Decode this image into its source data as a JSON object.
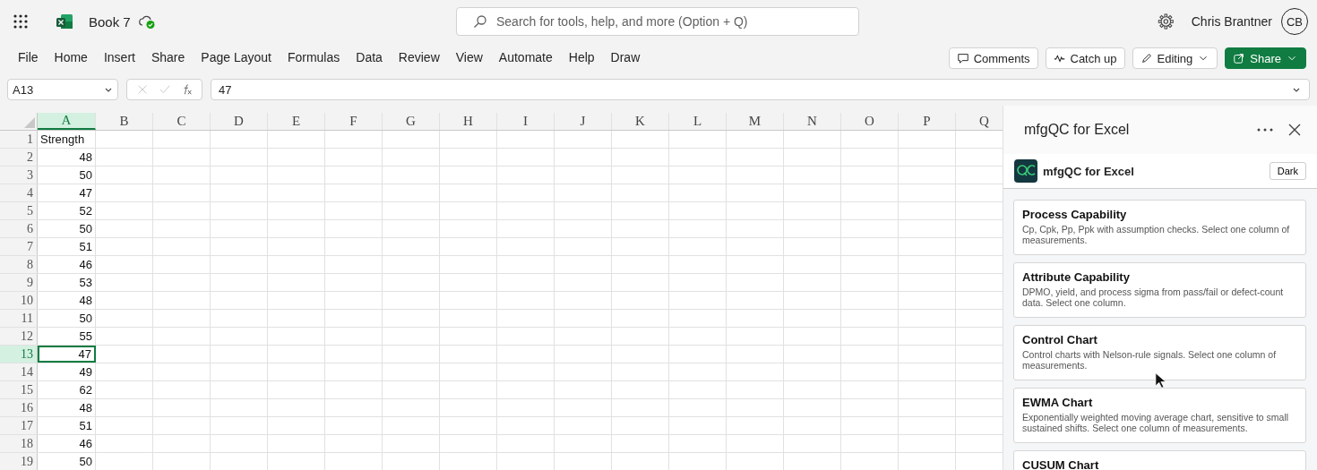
{
  "app_bar": {
    "file_name": "Book 7",
    "search_placeholder": "Search for tools, help, and more (Option + Q)",
    "user_name": "Chris Brantner",
    "user_initials": "CB"
  },
  "menu_tabs": [
    {
      "label": "File",
      "selected": false
    },
    {
      "label": "Home",
      "selected": false
    },
    {
      "label": "Insert",
      "selected": false
    },
    {
      "label": "Share",
      "selected": false
    },
    {
      "label": "Page Layout",
      "selected": false
    },
    {
      "label": "Formulas",
      "selected": false
    },
    {
      "label": "Data",
      "selected": false
    },
    {
      "label": "Review",
      "selected": false
    },
    {
      "label": "View",
      "selected": false
    },
    {
      "label": "Automate",
      "selected": false
    },
    {
      "label": "Help",
      "selected": false
    },
    {
      "label": "Draw",
      "selected": false
    }
  ],
  "actions": [
    {
      "label": "Comments",
      "kind": "comments"
    },
    {
      "label": "Catch up",
      "kind": "catchup"
    },
    {
      "label": "Editing",
      "kind": "editing"
    },
    {
      "label": "Share",
      "kind": "share"
    }
  ],
  "formula_bar": {
    "name_box": "A13",
    "formula": "47"
  },
  "grid": {
    "columns": [
      {
        "label": "A",
        "selected": true
      },
      {
        "label": "B",
        "selected": false
      },
      {
        "label": "C",
        "selected": false
      },
      {
        "label": "D",
        "selected": false
      },
      {
        "label": "E",
        "selected": false
      },
      {
        "label": "F",
        "selected": false
      },
      {
        "label": "G",
        "selected": false
      },
      {
        "label": "H",
        "selected": false
      },
      {
        "label": "I",
        "selected": false
      },
      {
        "label": "J",
        "selected": false
      },
      {
        "label": "K",
        "selected": false
      },
      {
        "label": "L",
        "selected": false
      },
      {
        "label": "M",
        "selected": false
      },
      {
        "label": "N",
        "selected": false
      },
      {
        "label": "O",
        "selected": false
      },
      {
        "label": "P",
        "selected": false
      },
      {
        "label": "Q",
        "selected": false
      }
    ],
    "rows": [
      {
        "number": "1",
        "selected": false,
        "cell": {
          "text": "Strength",
          "kind": "text"
        }
      },
      {
        "number": "2",
        "selected": false,
        "cell": {
          "text": "48",
          "kind": "number"
        }
      },
      {
        "number": "3",
        "selected": false,
        "cell": {
          "text": "50",
          "kind": "number"
        }
      },
      {
        "number": "4",
        "selected": false,
        "cell": {
          "text": "47",
          "kind": "number"
        }
      },
      {
        "number": "5",
        "selected": false,
        "cell": {
          "text": "52",
          "kind": "number"
        }
      },
      {
        "number": "6",
        "selected": false,
        "cell": {
          "text": "50",
          "kind": "number"
        }
      },
      {
        "number": "7",
        "selected": false,
        "cell": {
          "text": "51",
          "kind": "number"
        }
      },
      {
        "number": "8",
        "selected": false,
        "cell": {
          "text": "46",
          "kind": "number"
        }
      },
      {
        "number": "9",
        "selected": false,
        "cell": {
          "text": "53",
          "kind": "number"
        }
      },
      {
        "number": "10",
        "selected": false,
        "cell": {
          "text": "48",
          "kind": "number"
        }
      },
      {
        "number": "11",
        "selected": false,
        "cell": {
          "text": "50",
          "kind": "number"
        }
      },
      {
        "number": "12",
        "selected": false,
        "cell": {
          "text": "55",
          "kind": "number"
        }
      },
      {
        "number": "13",
        "selected": true,
        "cell": {
          "text": "47",
          "kind": "number"
        }
      },
      {
        "number": "14",
        "selected": false,
        "cell": {
          "text": "49",
          "kind": "number"
        }
      },
      {
        "number": "15",
        "selected": false,
        "cell": {
          "text": "62",
          "kind": "number"
        }
      },
      {
        "number": "16",
        "selected": false,
        "cell": {
          "text": "48",
          "kind": "number"
        }
      },
      {
        "number": "17",
        "selected": false,
        "cell": {
          "text": "51",
          "kind": "number"
        }
      },
      {
        "number": "18",
        "selected": false,
        "cell": {
          "text": "46",
          "kind": "number"
        }
      },
      {
        "number": "19",
        "selected": false,
        "cell": {
          "text": "50",
          "kind": "number"
        }
      }
    ]
  },
  "task_pane": {
    "title": "mfgQC for Excel",
    "addin_name": "mfgQC for Excel",
    "theme_button": "Dark",
    "cards": [
      {
        "title": "Process Capability",
        "description": "Cp, Cpk, Pp, Ppk with assumption checks. Select one column of measurements."
      },
      {
        "title": "Attribute Capability",
        "description": "DPMO, yield, and process sigma from pass/fail or defect-count data. Select one column."
      },
      {
        "title": "Control Chart",
        "description": "Control charts with Nelson-rule signals. Select one column of measurements."
      },
      {
        "title": "EWMA Chart",
        "description": "Exponentially weighted moving average chart, sensitive to small sustained shifts. Select one column of measurements."
      },
      {
        "title": "CUSUM Chart"
      }
    ]
  }
}
